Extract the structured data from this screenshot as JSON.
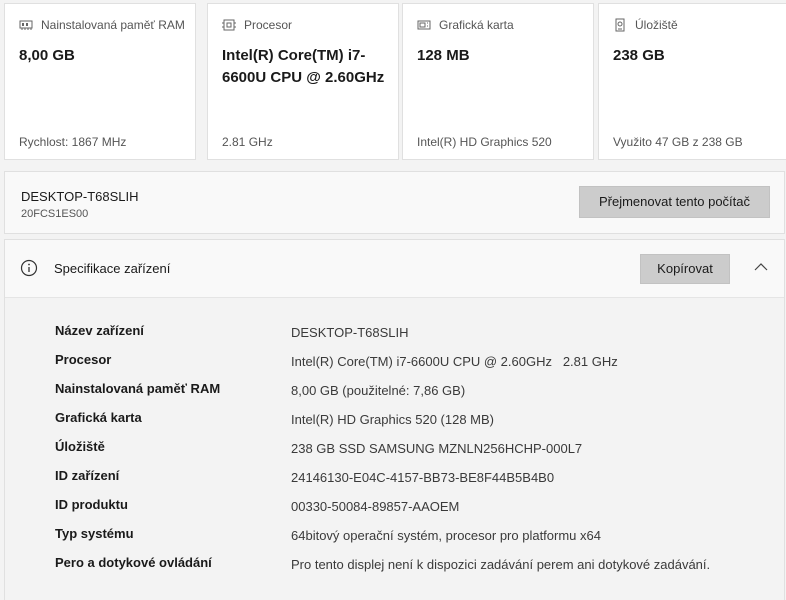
{
  "cards": [
    {
      "title": "Nainstalovaná paměť RAM",
      "icon": "memory-icon",
      "value": "8,00 GB",
      "sub": "Rychlost: 1867 MHz"
    },
    {
      "title": "Procesor",
      "icon": "processor-icon",
      "value": "Intel(R) Core(TM) i7-6600U CPU @ 2.60GHz",
      "sub": "2.81 GHz"
    },
    {
      "title": "Grafická karta",
      "icon": "graphics-card-icon",
      "value": "128 MB",
      "sub": "Intel(R) HD Graphics 520"
    },
    {
      "title": "Úložiště",
      "icon": "storage-icon",
      "value": "238 GB",
      "sub": "Využito 47 GB z 238 GB"
    }
  ],
  "pc": {
    "name": "DESKTOP-T68SLIH",
    "model": "20FCS1ES00",
    "rename_label": "Přejmenovat tento počítač"
  },
  "spec": {
    "title": "Specifikace zařízení",
    "copy_label": "Kopírovat",
    "rows": [
      {
        "key": "Název zařízení",
        "value": "DESKTOP-T68SLIH"
      },
      {
        "key": "Procesor",
        "value": "Intel(R) Core(TM) i7-6600U CPU @ 2.60GHz   2.81 GHz"
      },
      {
        "key": "Nainstalovaná paměť RAM",
        "value": "8,00 GB (použitelné: 7,86 GB)"
      },
      {
        "key": "Grafická karta",
        "value": "Intel(R) HD Graphics 520 (128 MB)"
      },
      {
        "key": "Úložiště",
        "value": "238 GB SSD SAMSUNG MZNLN256HCHP-000L7"
      },
      {
        "key": "ID zařízení",
        "value": "24146130-E04C-4157-BB73-BE8F44B5B4B0"
      },
      {
        "key": "ID produktu",
        "value": "00330-50084-89857-AAOEM"
      },
      {
        "key": "Typ systému",
        "value": "64bitový operační systém, procesor pro platformu x64"
      },
      {
        "key": "Pero a dotykové ovládání",
        "value": "Pro tento displej není k dispozici zadávání perem ani dotykové zadávání."
      }
    ]
  }
}
